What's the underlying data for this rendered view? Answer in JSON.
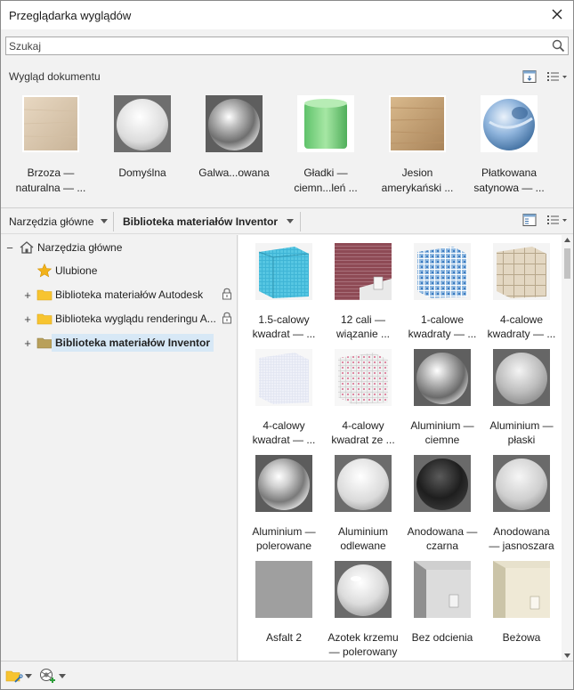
{
  "window": {
    "title": "Przeglądarka wyglądów"
  },
  "search": {
    "placeholder": "Szukaj"
  },
  "document_appearances": {
    "header": "Wygląd dokumentu",
    "items": [
      {
        "label": "Brzoza —\nnaturalna — ...",
        "icon": "birch-wood-cube-thumbnail"
      },
      {
        "label": "Domyślna",
        "icon": "default-white-sphere-thumbnail"
      },
      {
        "label": "Galwa...owana",
        "icon": "galvanized-sphere-thumbnail"
      },
      {
        "label": "Gładki —\nciemn...leń ...",
        "icon": "smooth-green-cylinder-thumbnail"
      },
      {
        "label": "Jesion\namerykański ...",
        "icon": "ash-wood-cube-thumbnail"
      },
      {
        "label": "Płatkowana\nsatynowa — ...",
        "icon": "blue-satin-sphere-thumbnail"
      }
    ]
  },
  "toolbar": {
    "library_dropdown_1": "Narzędzia główne",
    "library_dropdown_2": "Biblioteka materiałów Inventor"
  },
  "tree": {
    "root": "Narzędzia główne",
    "items": [
      {
        "label": "Ulubione",
        "icon": "star-icon",
        "expandable": false,
        "locked": false,
        "selected": false
      },
      {
        "label": "Biblioteka materiałów Autodesk",
        "icon": "folder-icon",
        "expandable": true,
        "locked": true,
        "selected": false
      },
      {
        "label": "Biblioteka wyglądu renderingu A...",
        "icon": "folder-icon",
        "expandable": true,
        "locked": true,
        "selected": false
      },
      {
        "label": "Biblioteka materiałów Inventor",
        "icon": "folder-icon",
        "expandable": true,
        "locked": false,
        "selected": true
      }
    ]
  },
  "materials": {
    "items": [
      {
        "label": "1.5-calowy\nkwadrat — ...",
        "icon": "teal-tile-cube-thumbnail"
      },
      {
        "label": "12 cali —\nwiązanie ...",
        "icon": "brick-wall-thumbnail"
      },
      {
        "label": "1-calowe\nkwadraty — ...",
        "icon": "blue-mosaic-cube-thumbnail"
      },
      {
        "label": "4-calowe\nkwadraty — ...",
        "icon": "beige-tile-cube-thumbnail"
      },
      {
        "label": "4-calowy\nkwadrat — ...",
        "icon": "white-tile-cube-thumbnail"
      },
      {
        "label": "4-calowy\nkwadrat ze ...",
        "icon": "dotted-tile-cube-thumbnail"
      },
      {
        "label": "Aluminium —\nciemne",
        "icon": "dark-aluminum-sphere-thumbnail"
      },
      {
        "label": "Aluminium —\npłaski",
        "icon": "flat-aluminum-sphere-thumbnail"
      },
      {
        "label": "Aluminium —\npolerowane",
        "icon": "polished-aluminum-sphere-thumbnail"
      },
      {
        "label": "Aluminium\nodlewane",
        "icon": "cast-aluminum-sphere-thumbnail"
      },
      {
        "label": "Anodowana —\nczarna",
        "icon": "black-anodized-sphere-thumbnail"
      },
      {
        "label": "Anodowana\n— jasnoszara",
        "icon": "light-gray-anodized-sphere-thumbnail"
      },
      {
        "label": "Asfalt 2",
        "icon": "asphalt-swatch-thumbnail"
      },
      {
        "label": "Azotek krzemu\n— polerowany",
        "icon": "silicon-nitride-sphere-thumbnail"
      },
      {
        "label": "Bez odcienia",
        "icon": "no-tint-room-thumbnail"
      },
      {
        "label": "Beżowa",
        "icon": "beige-room-thumbnail"
      }
    ]
  }
}
